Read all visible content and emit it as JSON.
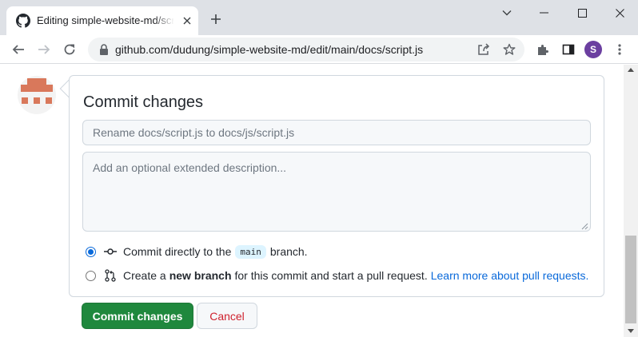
{
  "browser": {
    "tab_title": "Editing simple-website-md/script.js at main · dudung/simple-website-md",
    "url": "github.com/dudung/simple-website-md/edit/main/docs/script.js",
    "profile_initial": "S",
    "icons": {
      "tab_favicon": "github-icon",
      "tab_close": "close-icon",
      "new_tab": "plus-icon",
      "back": "back-arrow-icon",
      "forward": "forward-arrow-icon",
      "reload": "reload-icon",
      "lock": "lock-icon",
      "share": "share-icon",
      "bookmark": "star-icon",
      "extensions": "puzzle-icon",
      "side_panel": "side-panel-icon",
      "menu": "kebab-menu-icon"
    }
  },
  "commit_form": {
    "title": "Commit changes",
    "summary_placeholder": "Rename docs/script.js to docs/js/script.js",
    "description_placeholder": "Add an optional extended description...",
    "option_direct": {
      "prefix": "Commit directly to the",
      "branch": "main",
      "suffix": "branch.",
      "selected": true
    },
    "option_new_branch": {
      "prefix": "Create a",
      "bold": "new branch",
      "suffix": "for this commit and start a pull request.",
      "link": "Learn more about pull requests.",
      "selected": false
    },
    "commit_button": "Commit changes",
    "cancel_button": "Cancel"
  },
  "colors": {
    "primary_button": "#1f883d",
    "cancel_text": "#cf222e",
    "link": "#0969da",
    "avatar_identicon": "#d9785b",
    "profile_avatar": "#6b3fa0"
  }
}
